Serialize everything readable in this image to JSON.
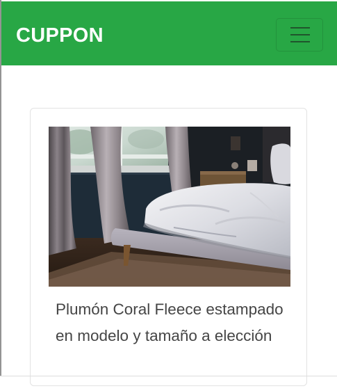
{
  "navbar": {
    "brand": "CUPPON",
    "background": "#28a745",
    "menu_icon": "hamburger-menu-icon"
  },
  "card": {
    "image_alt": "Bedroom with a bed covered by a white fleece comforter next to a curtained window",
    "title": "Plumón Coral Fleece estampado en modelo y tamaño a elección"
  }
}
